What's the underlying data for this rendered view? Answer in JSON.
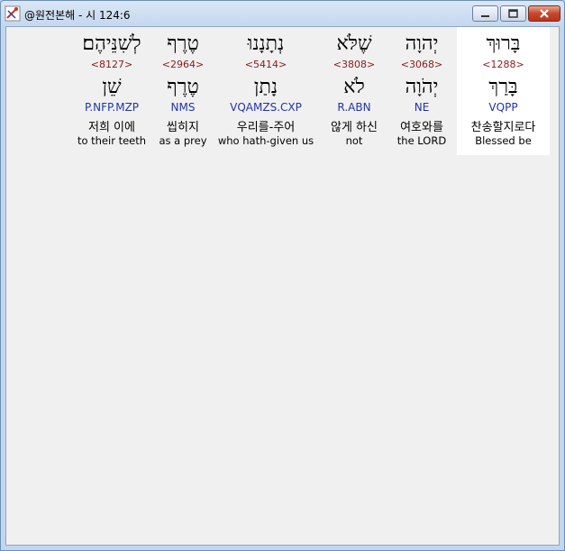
{
  "window": {
    "title": "@원전본해 - 시 124:6",
    "controls": {
      "minimize": "minimize",
      "maximize": "maximize",
      "close": "close"
    }
  },
  "words": [
    {
      "hebrew": "בָּרוּךְ",
      "strong": "<1288>",
      "lemma": "בָּרַךְ",
      "parsing": "VQPP",
      "korean": "찬송할지로다",
      "english": "Blessed be",
      "selected": true
    },
    {
      "hebrew": "יְהוָה",
      "strong": "<3068>",
      "lemma": "יְהֹוָה",
      "parsing": "NE",
      "korean": "여호와를",
      "english": "the LORD",
      "selected": false
    },
    {
      "hebrew": "שֶׁלֹּא",
      "strong": "<3808>",
      "lemma": "לֹא",
      "parsing": "R.ABN",
      "korean": "않게 하신",
      "english": "not",
      "selected": false
    },
    {
      "hebrew": "נְתָנָנוּ",
      "strong": "<5414>",
      "lemma": "נָתַן",
      "parsing": "VQAMZS.CXP",
      "korean": "우리를-주어",
      "english": "who hath-given us",
      "selected": false
    },
    {
      "hebrew": "טֶרֶף",
      "strong": "<2964>",
      "lemma": "טֶרֶף",
      "parsing": "NMS",
      "korean": "씹히지",
      "english": "as a prey",
      "selected": false
    },
    {
      "hebrew": "לְשִׁנֵּיהֶם׃",
      "strong": "<8127>",
      "lemma": "שֵׁן",
      "parsing": "P.NFP.MZP",
      "korean": "저희 이에",
      "english": "to their teeth",
      "selected": false
    }
  ]
}
